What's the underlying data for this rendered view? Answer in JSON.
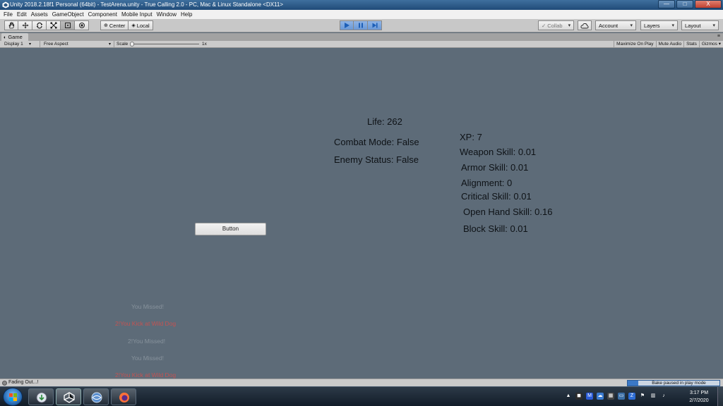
{
  "window": {
    "title": "Unity 2018.2.18f1 Personal (64bit) - TestArena.unity - True Calling 2.0 - PC, Mac & Linux Standalone <DX11>"
  },
  "window_buttons": [
    "—",
    "□",
    "X"
  ],
  "menu": [
    "File",
    "Edit",
    "Assets",
    "GameObject",
    "Component",
    "Mobile Input",
    "Window",
    "Help"
  ],
  "toolbar": {
    "pivot_label": "Center",
    "space_label": "Local",
    "collab_label": "Collab",
    "account_label": "Account",
    "layers_label": "Layers",
    "layout_label": "Layout"
  },
  "game_tab": {
    "label": "Game",
    "menu_icon": "≡"
  },
  "game_bar": {
    "display": "Display 1",
    "aspect": "Free Aspect",
    "scale_label": "Scale",
    "scale_value": "1x",
    "toggles": [
      "Maximize On Play",
      "Mute Audio",
      "Stats",
      "Gizmos"
    ]
  },
  "hud": {
    "life": "Life: 262",
    "combat_mode": "Combat Mode: False",
    "enemy_status": "Enemy Status: False",
    "xp": "XP: 7",
    "weapon_skill": "Weapon Skill: 0.01",
    "armor_skill": "Armor Skill: 0.01",
    "alignment": "Alignment: 0",
    "critical_skill": "Critical Skill: 0.01",
    "open_hand_skill": "Open Hand Skill: 0.16",
    "block_skill": "Block Skill: 0.01",
    "button_label": "Button"
  },
  "log": [
    {
      "text": "You Missed!",
      "tone": "gray"
    },
    {
      "text": "2!You Kick at Wild Dog",
      "tone": "red"
    },
    {
      "text": "2!You Missed!",
      "tone": "gray"
    },
    {
      "text": "You Missed!",
      "tone": "gray"
    },
    {
      "text": "2!You Kick at Wild Dog",
      "tone": "red"
    }
  ],
  "status": {
    "message": "Fading Out...!",
    "bake": "Bake paused in play mode"
  },
  "clock": {
    "time": "3:17 PM",
    "date": "2/7/2020"
  },
  "colors": {
    "game_bg": "#5d6b78",
    "play_active": "#6b98d6",
    "log_red": "#c45352"
  }
}
